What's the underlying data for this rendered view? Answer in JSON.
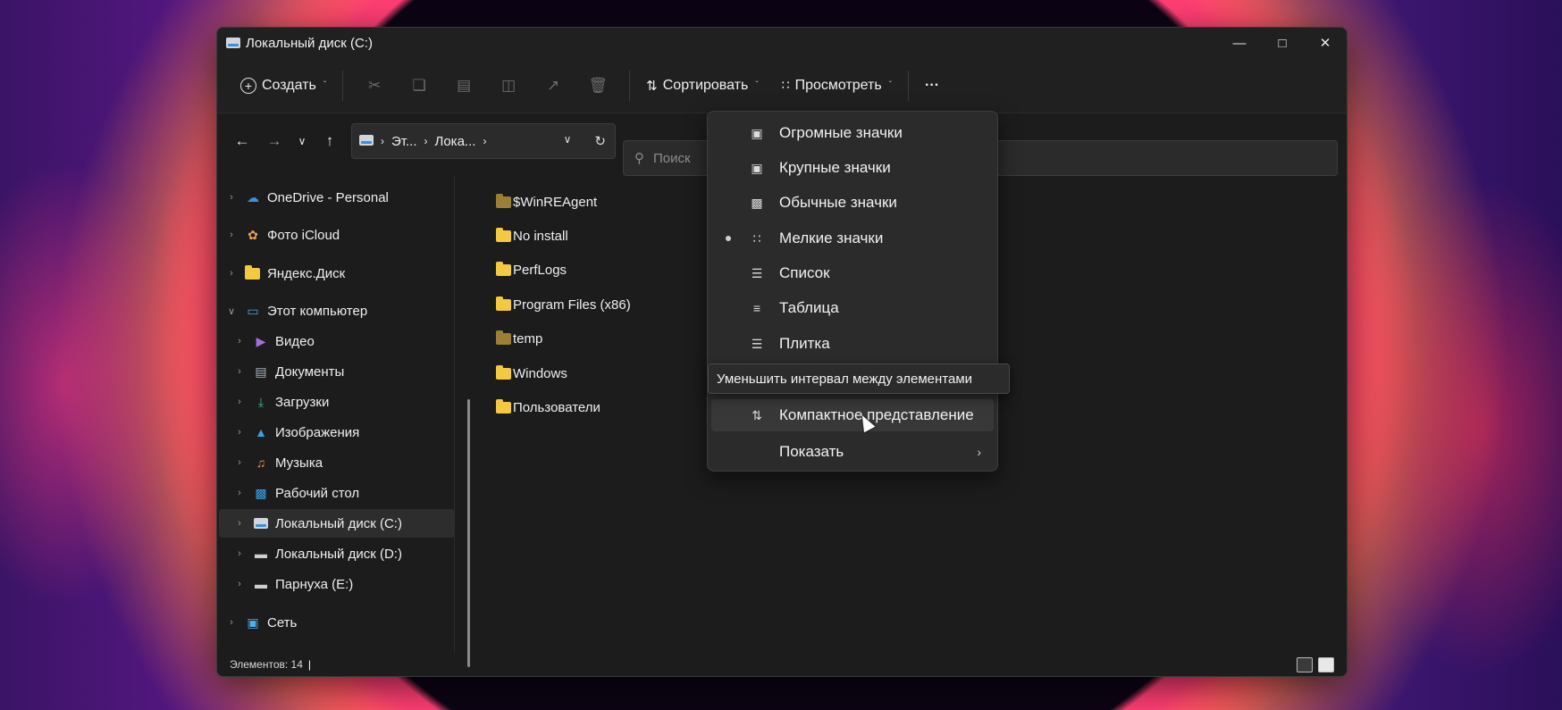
{
  "window": {
    "title": "Локальный диск (C:)"
  },
  "toolbar": {
    "create_label": "Создать",
    "sort_label": "Сортировать",
    "view_label": "Просмотреть",
    "more_label": "···"
  },
  "address": {
    "segments": [
      "Эт...",
      "Лока..."
    ],
    "search_placeholder": "Поиск"
  },
  "sidebar": {
    "items": [
      {
        "label": "OneDrive - Personal",
        "icon": "cloud-icon"
      },
      {
        "label": "Фото iCloud",
        "icon": "icloud-photos-icon"
      },
      {
        "label": "Яндекс.Диск",
        "icon": "yandex-disk-icon"
      },
      {
        "label": "Этот компьютер",
        "icon": "computer-icon"
      },
      {
        "label": "Видео",
        "icon": "video-icon"
      },
      {
        "label": "Документы",
        "icon": "documents-icon"
      },
      {
        "label": "Загрузки",
        "icon": "download-icon"
      },
      {
        "label": "Изображения",
        "icon": "pictures-icon"
      },
      {
        "label": "Музыка",
        "icon": "music-icon"
      },
      {
        "label": "Рабочий стол",
        "icon": "desktop-icon"
      },
      {
        "label": "Локальный диск (C:)",
        "icon": "drive-c-icon"
      },
      {
        "label": "Локальный диск (D:)",
        "icon": "drive-icon"
      },
      {
        "label": "Парнуха (E:)",
        "icon": "drive-icon"
      },
      {
        "label": "Сеть",
        "icon": "network-icon"
      }
    ]
  },
  "files": [
    {
      "name": "$WinREAgent"
    },
    {
      "name": "No install"
    },
    {
      "name": "PerfLogs"
    },
    {
      "name": "Program Files (x86)"
    },
    {
      "name": "temp"
    },
    {
      "name": "Windows"
    },
    {
      "name": "Пользователи"
    }
  ],
  "view_menu": {
    "items": [
      {
        "label": "Огромные значки"
      },
      {
        "label": "Крупные значки"
      },
      {
        "label": "Обычные значки"
      },
      {
        "label": "Мелкие значки",
        "selected": true
      },
      {
        "label": "Список"
      },
      {
        "label": "Таблица"
      },
      {
        "label": "Плитка"
      },
      {
        "label": "Компактное представление"
      },
      {
        "label": "Показать"
      }
    ],
    "tooltip": "Уменьшить интервал между элементами"
  },
  "status": {
    "items_count": "Элементов: 14"
  }
}
